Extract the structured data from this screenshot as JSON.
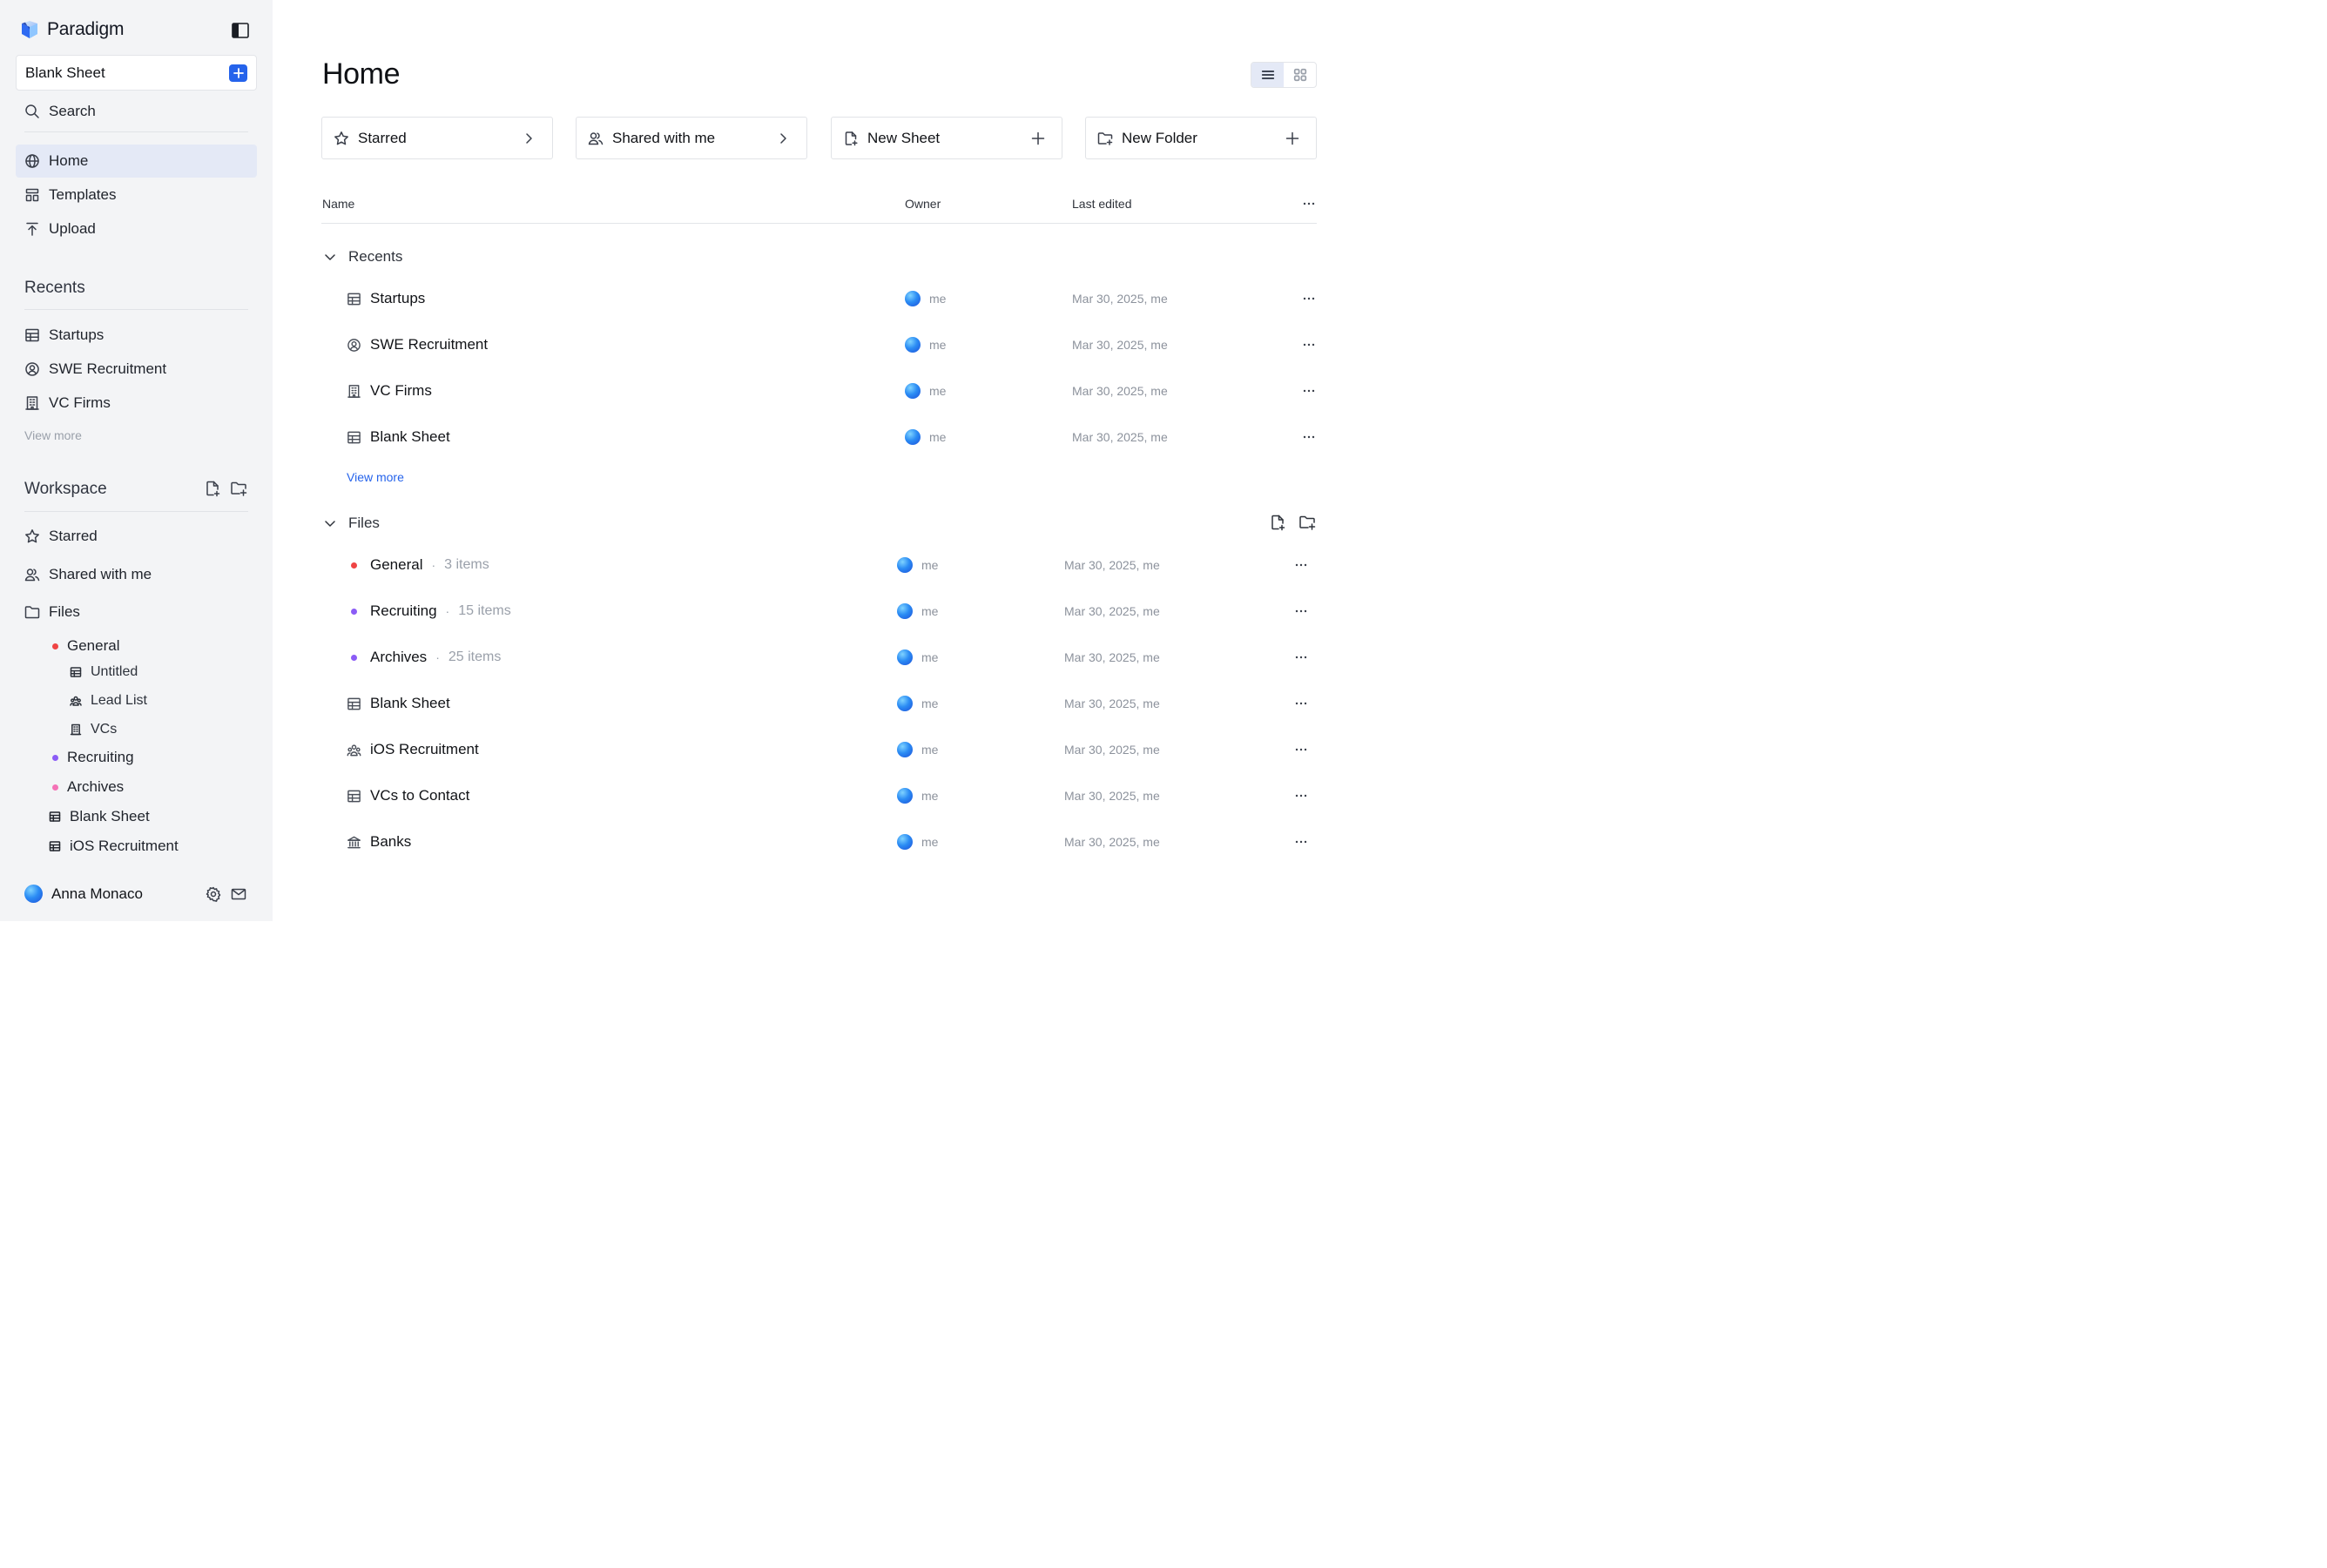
{
  "app": {
    "name": "Paradigm"
  },
  "colors": {
    "accent": "#2563eb",
    "dot_general": "#ef4444",
    "dot_recruiting": "#8b5cf6",
    "dot_archives": "#f472b6"
  },
  "sidebar": {
    "blank_sheet_label": "Blank Sheet",
    "search_label": "Search",
    "nav": [
      {
        "label": "Home",
        "icon": "globe-icon"
      },
      {
        "label": "Templates",
        "icon": "templates-icon"
      },
      {
        "label": "Upload",
        "icon": "upload-icon"
      }
    ],
    "recents_title": "Recents",
    "recents": [
      {
        "label": "Startups",
        "icon": "table-icon"
      },
      {
        "label": "SWE Recruitment",
        "icon": "user-circle-icon"
      },
      {
        "label": "VC Firms",
        "icon": "building-icon"
      }
    ],
    "view_more": "View more",
    "workspace_title": "Workspace",
    "workspace": [
      {
        "label": "Starred",
        "icon": "star-icon"
      },
      {
        "label": "Shared with me",
        "icon": "users-icon"
      },
      {
        "label": "Files",
        "icon": "folder-icon"
      }
    ],
    "tree": {
      "general": "General",
      "general_children": [
        "Untitled",
        "Lead List",
        "VCs"
      ],
      "recruiting": "Recruiting",
      "archives": "Archives",
      "blank_sheet": "Blank Sheet",
      "ios_recruitment": "iOS Recruitment"
    },
    "user_name": "Anna Monaco"
  },
  "main": {
    "title": "Home",
    "cards": [
      {
        "label": "Starred",
        "icon": "star-icon",
        "trail": "chevron-right-icon"
      },
      {
        "label": "Shared with me",
        "icon": "users-icon",
        "trail": "chevron-right-icon"
      },
      {
        "label": "New Sheet",
        "icon": "file-plus-icon",
        "trail": "plus-icon"
      },
      {
        "label": "New Folder",
        "icon": "folder-plus-icon",
        "trail": "plus-icon"
      }
    ],
    "columns": {
      "name": "Name",
      "owner": "Owner",
      "last_edited": "Last edited"
    },
    "recents_group": "Recents",
    "recents": [
      {
        "name": "Startups",
        "icon": "table-icon",
        "owner": "me",
        "edited": "Mar 30, 2025, me"
      },
      {
        "name": "SWE Recruitment",
        "icon": "user-circle-icon",
        "owner": "me",
        "edited": "Mar 30, 2025, me"
      },
      {
        "name": "VC Firms",
        "icon": "building-icon",
        "owner": "me",
        "edited": "Mar 30, 2025, me"
      },
      {
        "name": "Blank Sheet",
        "icon": "table-icon",
        "owner": "me",
        "edited": "Mar 30, 2025, me"
      }
    ],
    "view_more": "View more",
    "files_group": "Files",
    "files": [
      {
        "name": "General",
        "kind": "folder",
        "dot": "#ef4444",
        "count": "3 items",
        "owner": "me",
        "edited": "Mar 30, 2025, me"
      },
      {
        "name": "Recruiting",
        "kind": "folder",
        "dot": "#8b5cf6",
        "count": "15 items",
        "owner": "me",
        "edited": "Mar 30, 2025, me"
      },
      {
        "name": "Archives",
        "kind": "folder",
        "dot": "#8b5cf6",
        "count": "25 items",
        "owner": "me",
        "edited": "Mar 30, 2025, me"
      },
      {
        "name": "Blank Sheet",
        "icon": "table-icon",
        "owner": "me",
        "edited": "Mar 30, 2025, me"
      },
      {
        "name": "iOS Recruitment",
        "icon": "group-icon",
        "owner": "me",
        "edited": "Mar 30, 2025, me"
      },
      {
        "name": "VCs to Contact",
        "icon": "table-icon",
        "owner": "me",
        "edited": "Mar 30, 2025, me"
      },
      {
        "name": "Banks",
        "icon": "bank-icon",
        "owner": "me",
        "edited": "Mar 30, 2025, me"
      }
    ]
  }
}
